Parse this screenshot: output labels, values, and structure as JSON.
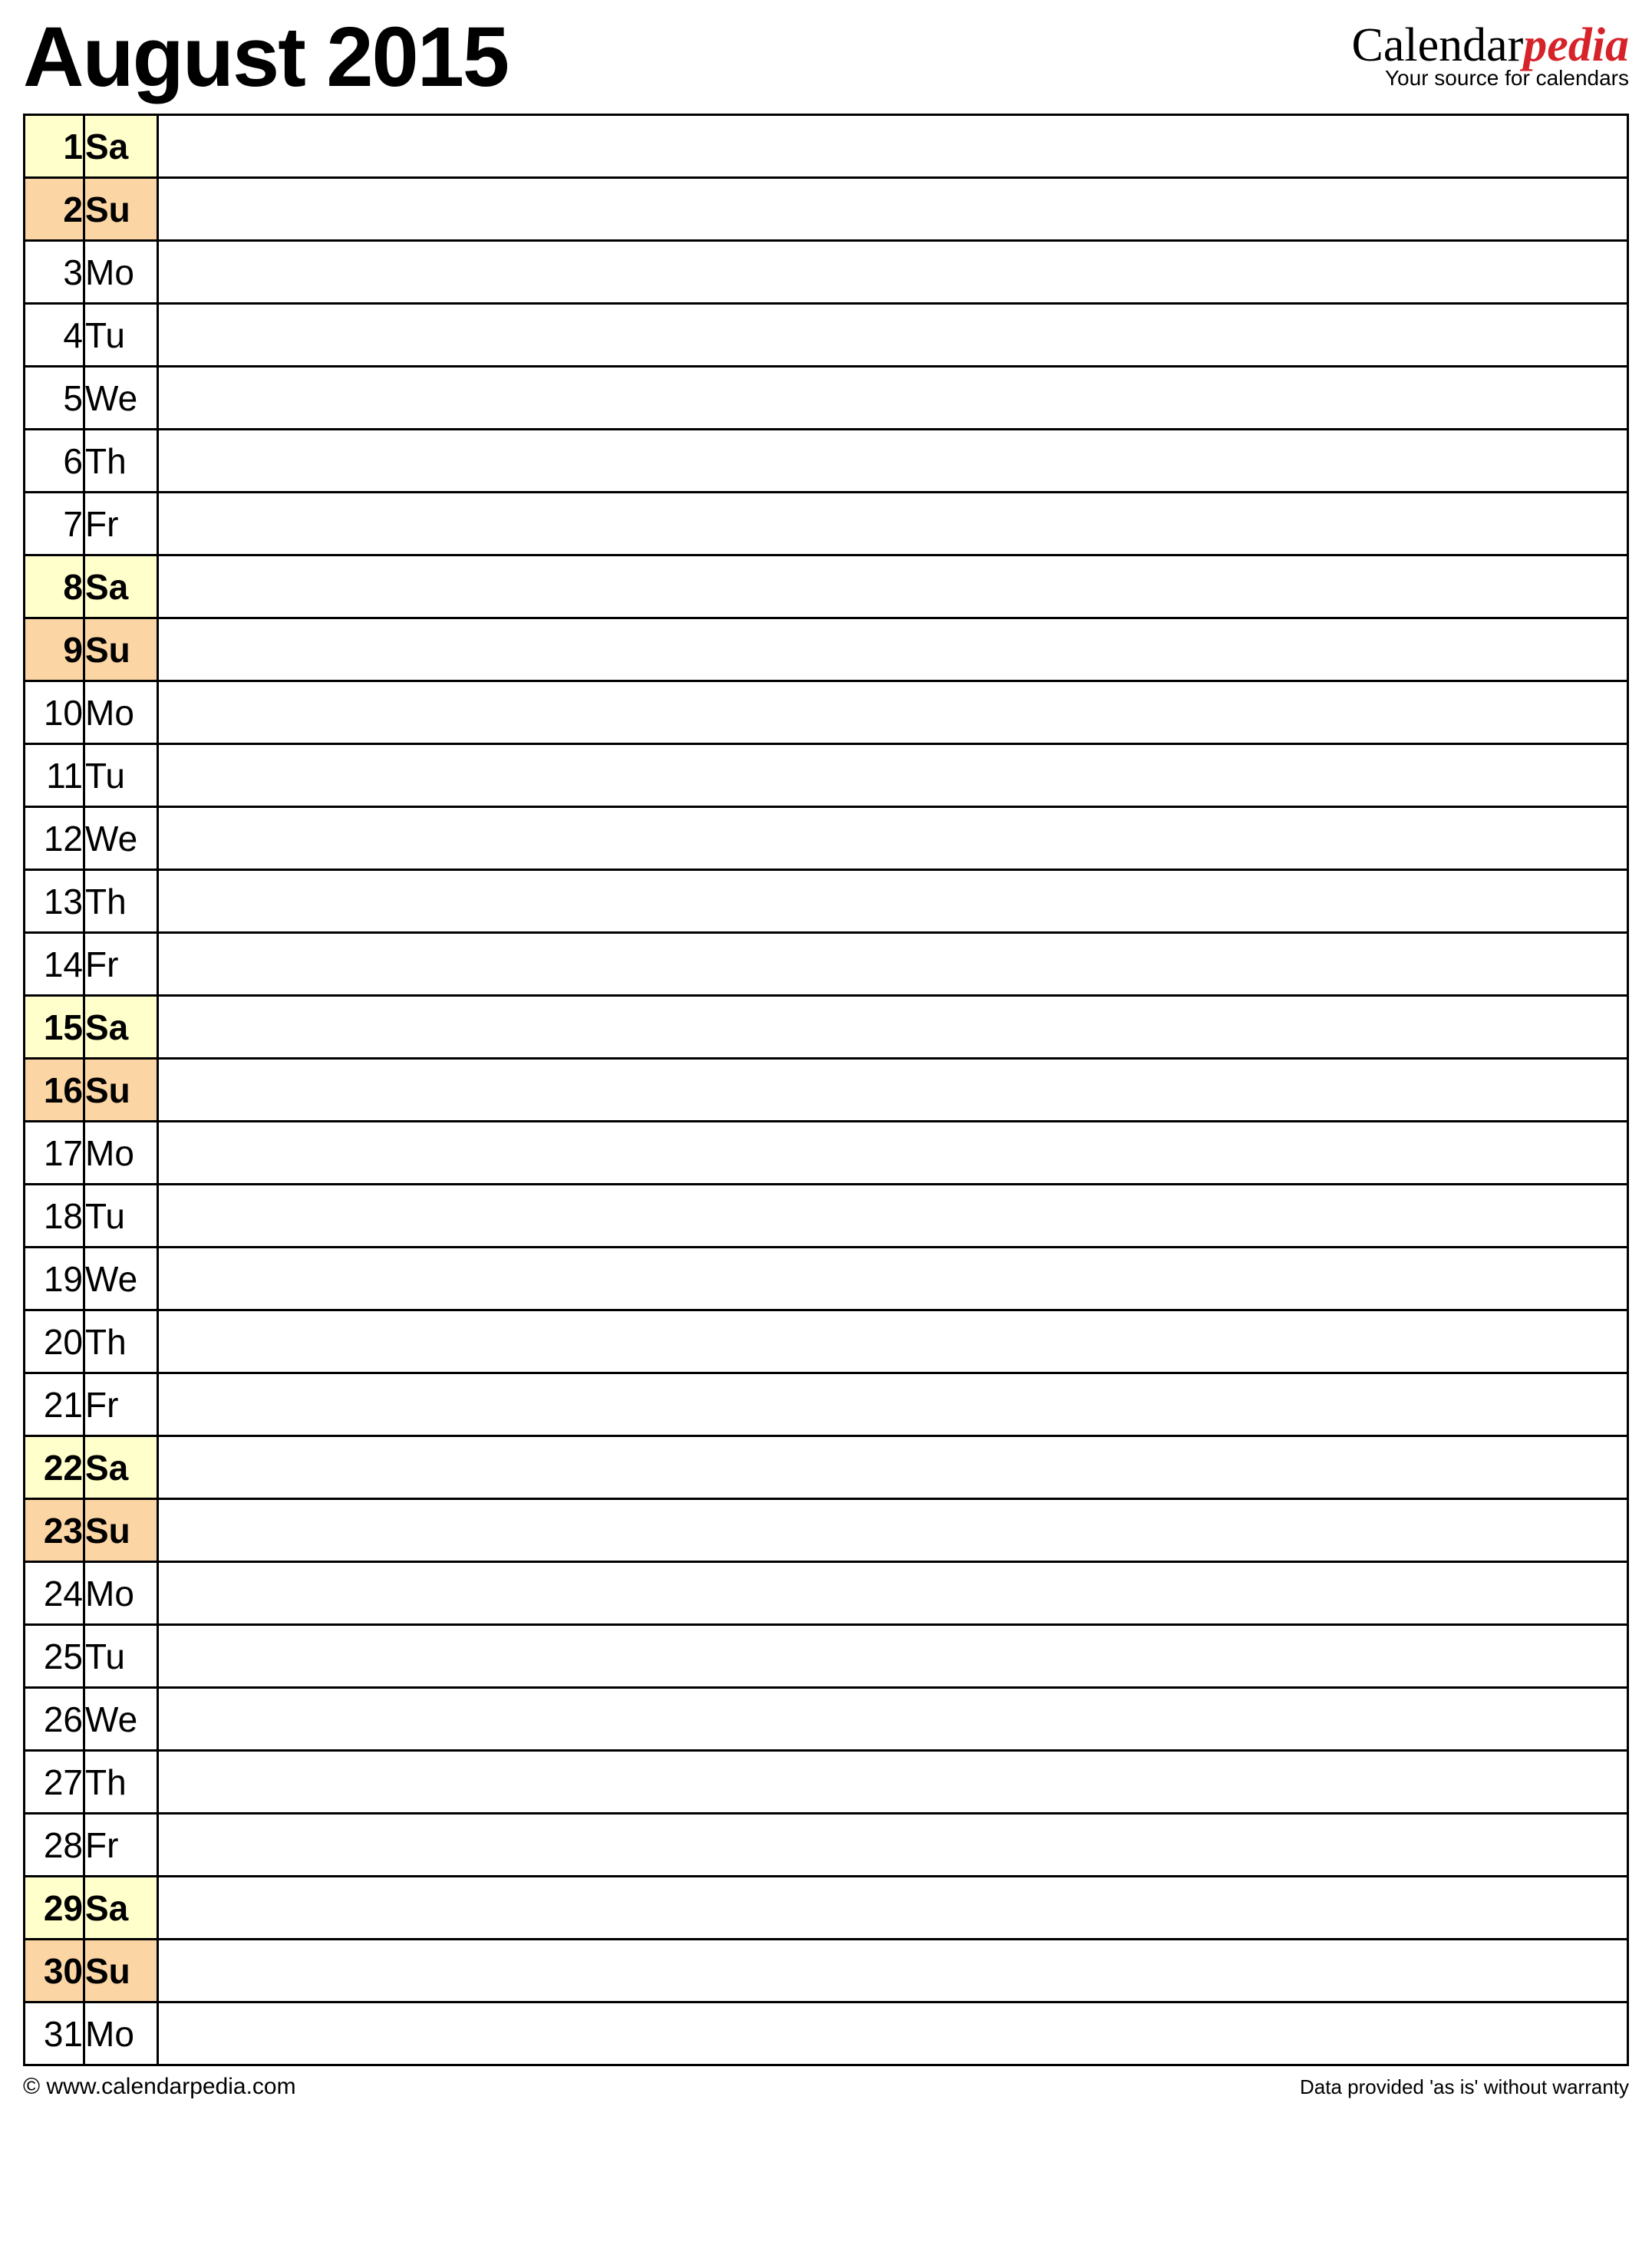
{
  "header": {
    "title": "August 2015",
    "brand_prefix": "Calendar",
    "brand_accent": "pedia",
    "brand_tagline": "Your source for calendars"
  },
  "days": [
    {
      "n": "1",
      "abbr": "Sa",
      "type": "sat"
    },
    {
      "n": "2",
      "abbr": "Su",
      "type": "sun"
    },
    {
      "n": "3",
      "abbr": "Mo",
      "type": "wk"
    },
    {
      "n": "4",
      "abbr": "Tu",
      "type": "wk"
    },
    {
      "n": "5",
      "abbr": "We",
      "type": "wk"
    },
    {
      "n": "6",
      "abbr": "Th",
      "type": "wk"
    },
    {
      "n": "7",
      "abbr": "Fr",
      "type": "wk"
    },
    {
      "n": "8",
      "abbr": "Sa",
      "type": "sat"
    },
    {
      "n": "9",
      "abbr": "Su",
      "type": "sun"
    },
    {
      "n": "10",
      "abbr": "Mo",
      "type": "wk"
    },
    {
      "n": "11",
      "abbr": "Tu",
      "type": "wk"
    },
    {
      "n": "12",
      "abbr": "We",
      "type": "wk"
    },
    {
      "n": "13",
      "abbr": "Th",
      "type": "wk"
    },
    {
      "n": "14",
      "abbr": "Fr",
      "type": "wk"
    },
    {
      "n": "15",
      "abbr": "Sa",
      "type": "sat"
    },
    {
      "n": "16",
      "abbr": "Su",
      "type": "sun"
    },
    {
      "n": "17",
      "abbr": "Mo",
      "type": "wk"
    },
    {
      "n": "18",
      "abbr": "Tu",
      "type": "wk"
    },
    {
      "n": "19",
      "abbr": "We",
      "type": "wk"
    },
    {
      "n": "20",
      "abbr": "Th",
      "type": "wk"
    },
    {
      "n": "21",
      "abbr": "Fr",
      "type": "wk"
    },
    {
      "n": "22",
      "abbr": "Sa",
      "type": "sat"
    },
    {
      "n": "23",
      "abbr": "Su",
      "type": "sun"
    },
    {
      "n": "24",
      "abbr": "Mo",
      "type": "wk"
    },
    {
      "n": "25",
      "abbr": "Tu",
      "type": "wk"
    },
    {
      "n": "26",
      "abbr": "We",
      "type": "wk"
    },
    {
      "n": "27",
      "abbr": "Th",
      "type": "wk"
    },
    {
      "n": "28",
      "abbr": "Fr",
      "type": "wk"
    },
    {
      "n": "29",
      "abbr": "Sa",
      "type": "sat"
    },
    {
      "n": "30",
      "abbr": "Su",
      "type": "sun"
    },
    {
      "n": "31",
      "abbr": "Mo",
      "type": "wk"
    }
  ],
  "footer": {
    "copyright": "© www.calendarpedia.com",
    "disclaimer": "Data provided 'as is' without warranty"
  }
}
